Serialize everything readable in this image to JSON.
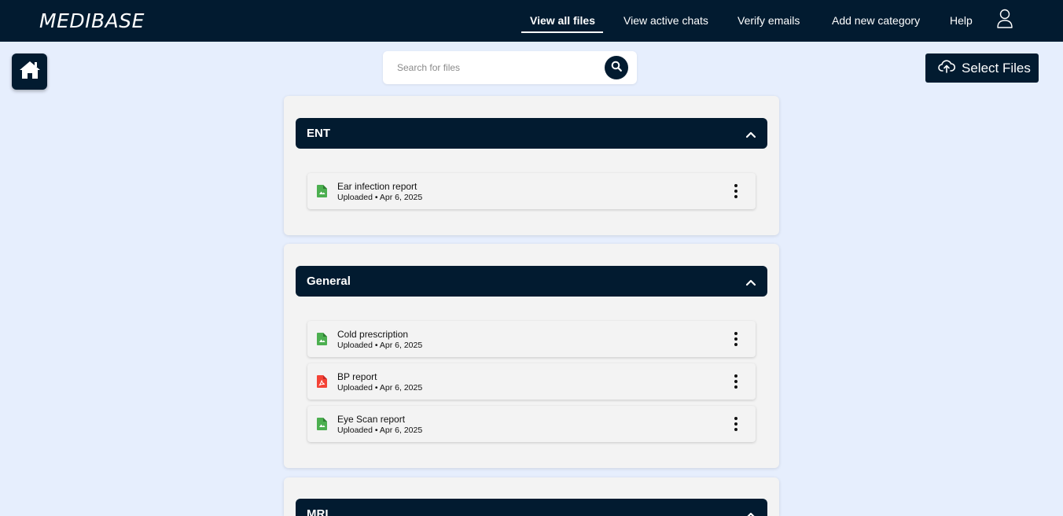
{
  "app": {
    "brand": "MEDIBASE"
  },
  "nav": {
    "items": [
      {
        "label": "View all files",
        "active": true
      },
      {
        "label": "View active chats",
        "active": false
      },
      {
        "label": "Verify emails",
        "active": false
      },
      {
        "label": "Add new category",
        "active": false
      },
      {
        "label": "Help",
        "active": false
      }
    ],
    "user_icon": "user-icon"
  },
  "home": {
    "icon": "home-icon"
  },
  "search": {
    "placeholder": "Search for files",
    "value": "",
    "icon": "search-icon"
  },
  "upload": {
    "label": "Select Files",
    "icon": "cloud-upload-icon"
  },
  "categories": [
    {
      "title": "ENT",
      "expanded": true,
      "files": [
        {
          "name": "Ear infection report",
          "meta": "Uploaded • Apr 6, 2025",
          "type": "image",
          "icon_color": "#4caf50"
        }
      ]
    },
    {
      "title": "General",
      "expanded": true,
      "files": [
        {
          "name": "Cold prescription",
          "meta": "Uploaded • Apr 6, 2025",
          "type": "image",
          "icon_color": "#4caf50"
        },
        {
          "name": "BP report",
          "meta": "Uploaded • Apr 6, 2025",
          "type": "pdf",
          "icon_color": "#f44336"
        },
        {
          "name": "Eye Scan report",
          "meta": "Uploaded • Apr 6, 2025",
          "type": "image",
          "icon_color": "#4caf50"
        }
      ]
    },
    {
      "title": "MRI",
      "expanded": true,
      "files": []
    }
  ],
  "colors": {
    "primary": "#021b30",
    "background": "#e6eefd",
    "card": "#f3f3f3"
  }
}
